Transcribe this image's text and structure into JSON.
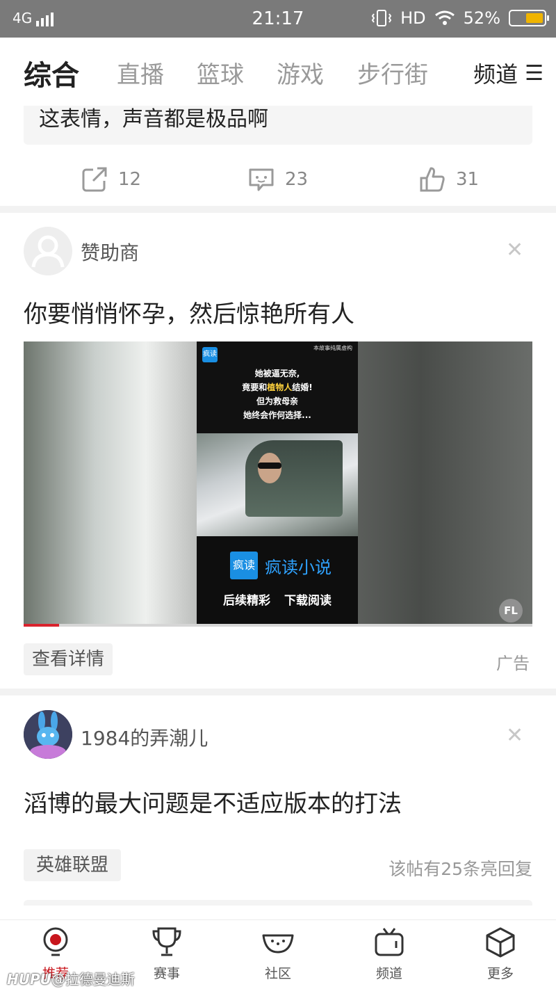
{
  "status_bar": {
    "network": "4G",
    "time": "21:17",
    "hd": "HD",
    "battery_percent": "52%",
    "battery_level": 0.52
  },
  "top_nav": {
    "tabs": [
      {
        "label": "综合",
        "active": true
      },
      {
        "label": "直播",
        "active": false
      },
      {
        "label": "篮球",
        "active": false
      },
      {
        "label": "游戏",
        "active": false
      },
      {
        "label": "步行街",
        "active": false
      }
    ],
    "channel_label": "频道",
    "menu_glyph": "☰"
  },
  "card1": {
    "quote_text": "这表情，声音都是极品啊",
    "share_count": "12",
    "comment_count": "23",
    "like_count": "31"
  },
  "ad_card": {
    "username": "赞助商",
    "title": "你要悄悄怀孕，然后惊艳所有人",
    "video": {
      "small_logo": "疯读",
      "note": "本故事纯属虚构",
      "line1": "她被逼无奈,",
      "line2_pre": "竟要和",
      "line2_highlight": "植物人",
      "line2_post": "结婚!",
      "line3": "但为救母亲",
      "line4": "她终会作何选择...",
      "brand_logo": "疯读",
      "brand_name": "疯读小说",
      "cta": "后续精彩 下载阅读",
      "badge": "FL",
      "progress": 0.07
    },
    "detail_button": "查看详情",
    "ad_label": "广告"
  },
  "post_card": {
    "username": "1984的弄潮儿",
    "title": "滔博的最大问题是不适应版本的打法",
    "tag": "英雄联盟",
    "reply_info": "该帖有25条亮回复"
  },
  "bottom_nav": {
    "items": [
      {
        "label": "推荐",
        "icon": "recommend-icon",
        "active": true
      },
      {
        "label": "赛事",
        "icon": "trophy-icon",
        "active": false
      },
      {
        "label": "社区",
        "icon": "watermelon-icon",
        "active": false
      },
      {
        "label": "频道",
        "icon": "tv-icon",
        "active": false
      },
      {
        "label": "更多",
        "icon": "cube-icon",
        "active": false
      }
    ]
  },
  "watermark": {
    "brand": "HUPU",
    "handle": "@拉德曼迪斯"
  },
  "colors": {
    "accent": "#c8161d",
    "status_bar": "#7a7a7a",
    "battery": "#f0b400",
    "brand_blue": "#1a8fe3"
  }
}
